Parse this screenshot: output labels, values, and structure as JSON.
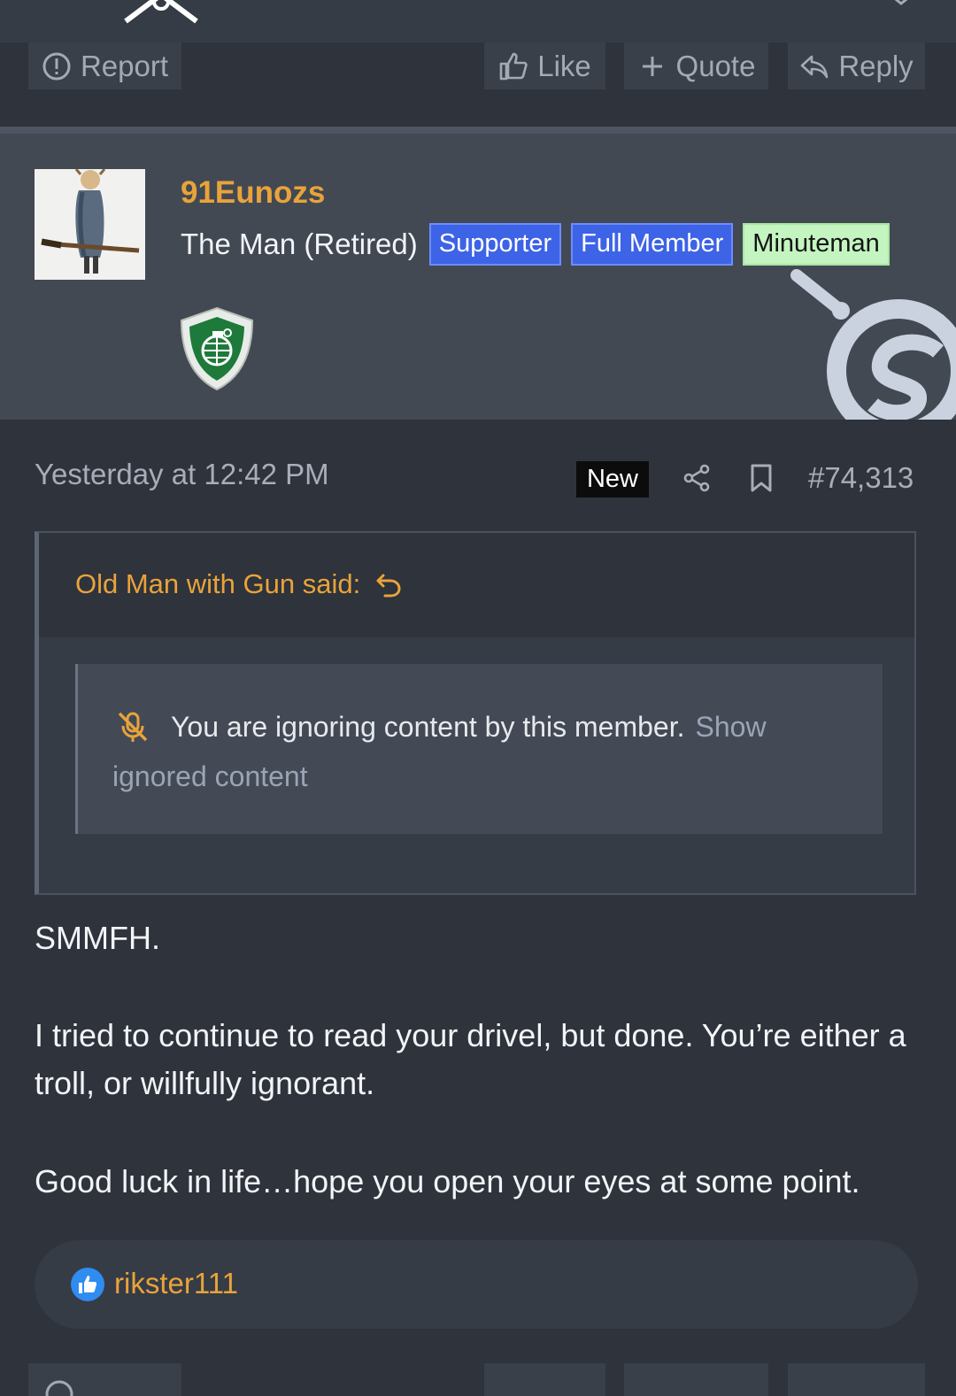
{
  "previous_post": {
    "actions": {
      "report_label": "Report",
      "like_label": "Like",
      "quote_label": "Quote",
      "reply_label": "Reply"
    }
  },
  "post": {
    "author": {
      "username": "91Eunozs",
      "title": "The Man (Retired)",
      "badges": [
        "Supporter",
        "Full Member",
        "Minuteman"
      ]
    },
    "date": "Yesterday at 12:42 PM",
    "new_label": "New",
    "post_number": "#74,313",
    "quote": {
      "author_line": "Old Man with Gun said:",
      "ignored_text": "You are ignoring content by this member.",
      "show_link_part1": "Show",
      "show_link_part2": "ignored content"
    },
    "body": [
      "SMMFH.",
      "I tried to continue to read your drivel, but done. You’re either a troll, or willfully ignorant.",
      "Good luck in life…hope you open your eyes at some point."
    ],
    "reactions": {
      "icon": "like-icon",
      "user": "rikster111"
    }
  },
  "colors": {
    "background": "#2e333c",
    "accent_orange": "#e9a33a",
    "badge_blue": "#3d63e6",
    "badge_green": "#c4f5c0"
  }
}
